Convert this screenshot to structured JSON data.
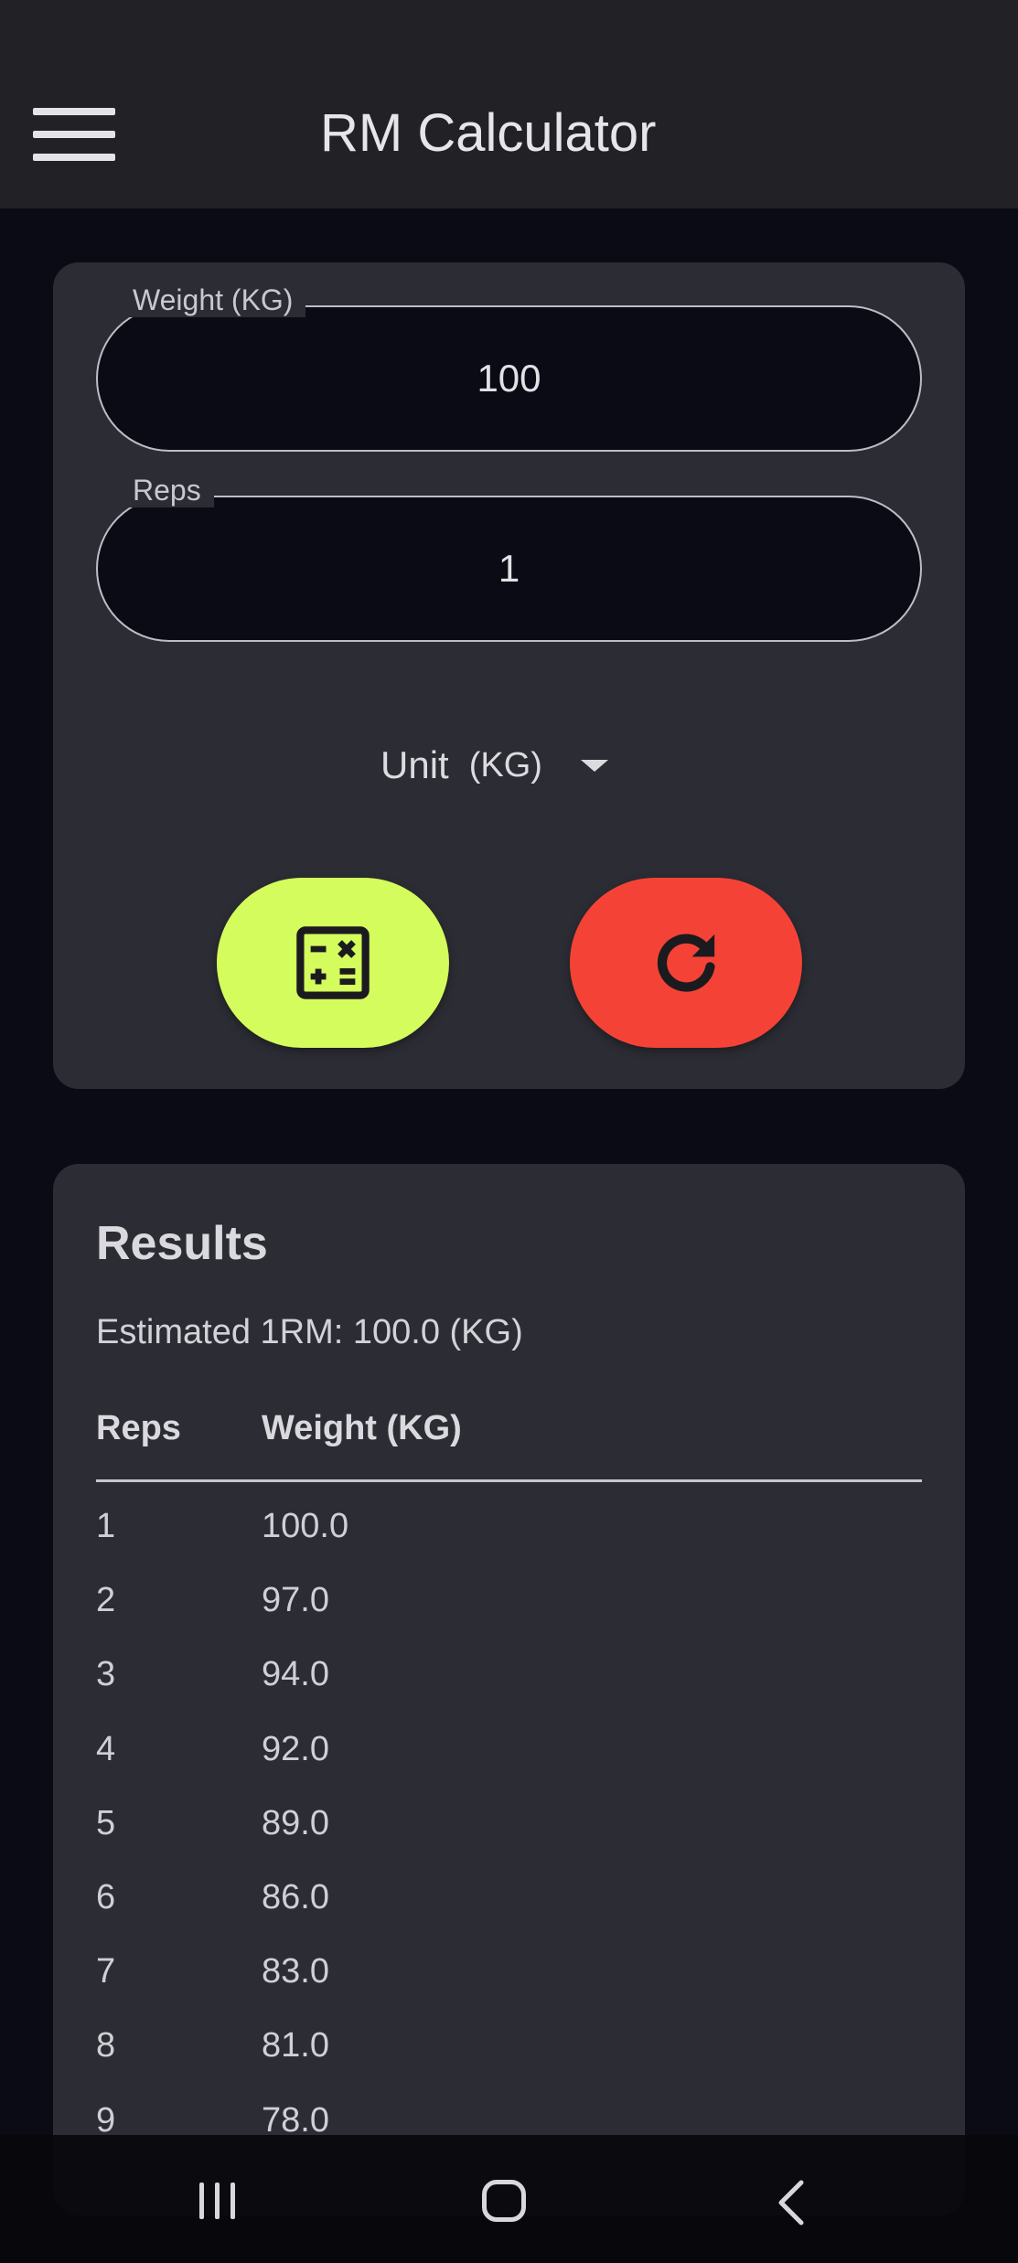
{
  "app": {
    "title": "RM Calculator",
    "menu_icon": "hamburger-menu-icon"
  },
  "form": {
    "weight": {
      "label": "Weight (KG)",
      "value": "100"
    },
    "reps": {
      "label": "Reps",
      "value": "1"
    },
    "unit": {
      "label": "Unit",
      "value": "(KG)",
      "caret_icon": "dropdown-caret-icon"
    },
    "calculate_button": {
      "icon": "calculator-icon",
      "color": "#d4fc5c"
    },
    "reset_button": {
      "icon": "refresh-icon",
      "color": "#f44336"
    }
  },
  "results": {
    "title": "Results",
    "estimate": "Estimated 1RM: 100.0 (KG)",
    "columns": {
      "reps": "Reps",
      "weight": "Weight (KG)"
    },
    "rows": [
      {
        "reps": "1",
        "weight": "100.0"
      },
      {
        "reps": "2",
        "weight": "97.0"
      },
      {
        "reps": "3",
        "weight": "94.0"
      },
      {
        "reps": "4",
        "weight": "92.0"
      },
      {
        "reps": "5",
        "weight": "89.0"
      },
      {
        "reps": "6",
        "weight": "86.0"
      },
      {
        "reps": "7",
        "weight": "83.0"
      },
      {
        "reps": "8",
        "weight": "81.0"
      },
      {
        "reps": "9",
        "weight": "78.0"
      }
    ]
  },
  "navbar": {
    "recents_icon": "recents-icon",
    "home_icon": "home-icon",
    "back_icon": "back-icon"
  },
  "colors": {
    "background": "#0b0b15",
    "appbar": "#222226",
    "card": "#2c2c34"
  }
}
